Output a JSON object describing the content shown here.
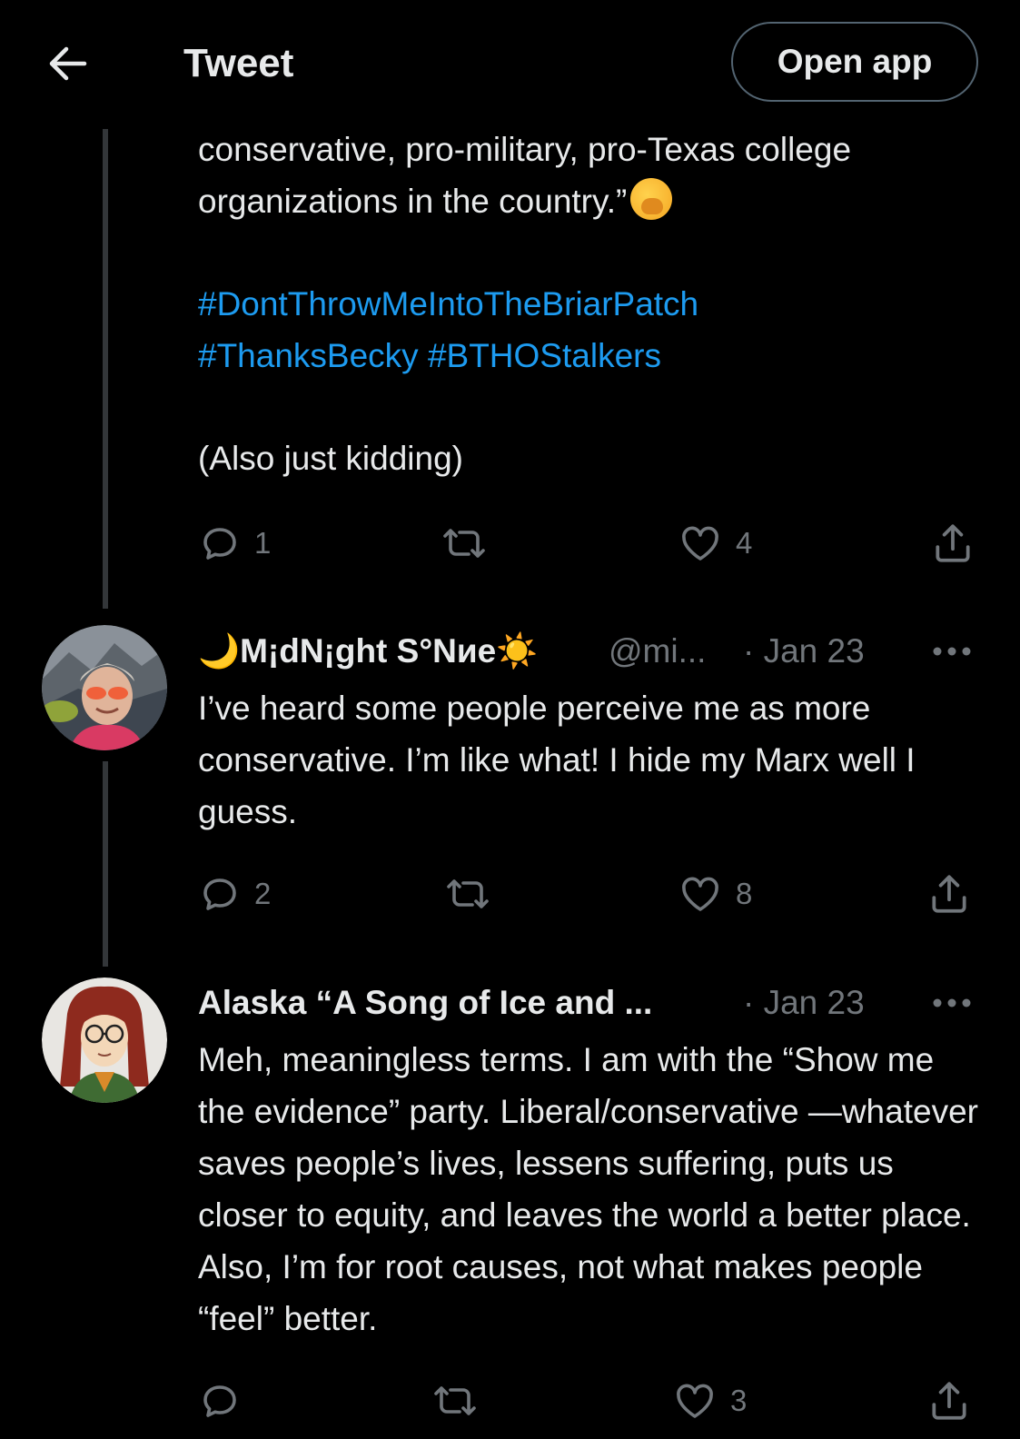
{
  "header": {
    "title": "Tweet",
    "open_app_label": "Open app"
  },
  "tweet_1": {
    "text_line_1": "conservative, pro-military, pro-Texas college",
    "text_line_2": "organizations in the country.”",
    "hashtags": [
      "#DontThrowMeIntoTheBriarPatch",
      "#ThanksBecky",
      "#BTHOStalkers"
    ],
    "closing_text": "(Also just kidding)",
    "replies": "1",
    "likes": "4"
  },
  "tweet_2": {
    "display_name": "🌙M¡dN¡ght S°Nиe☀️",
    "handle": "@mi...",
    "time": "· Jan 23",
    "text": "I’ve heard some people perceive me as more conservative. I’m like what! I hide my Marx well I guess.",
    "replies": "2",
    "likes": "8"
  },
  "tweet_3": {
    "display_name": "Alaska “A Song of Ice and ...",
    "time": "· Jan 23",
    "text": "Meh, meaningless terms. I am with the “Show me the evidence” party. Liberal/conservative —whatever saves people’s lives, lessens suffering, puts us closer to equity, and leaves the world a better place. Also, I’m for root causes, not what makes people “feel” better.",
    "likes": "3"
  },
  "colors": {
    "background": "#000000",
    "text": "#e7e9ea",
    "muted": "#71767b",
    "link": "#1d9bf0",
    "thread_line": "#333639"
  },
  "icons": {
    "back": "back-arrow-icon",
    "reply": "reply-icon",
    "retweet": "retweet-icon",
    "like": "heart-icon",
    "share": "share-icon",
    "more": "more-icon"
  }
}
